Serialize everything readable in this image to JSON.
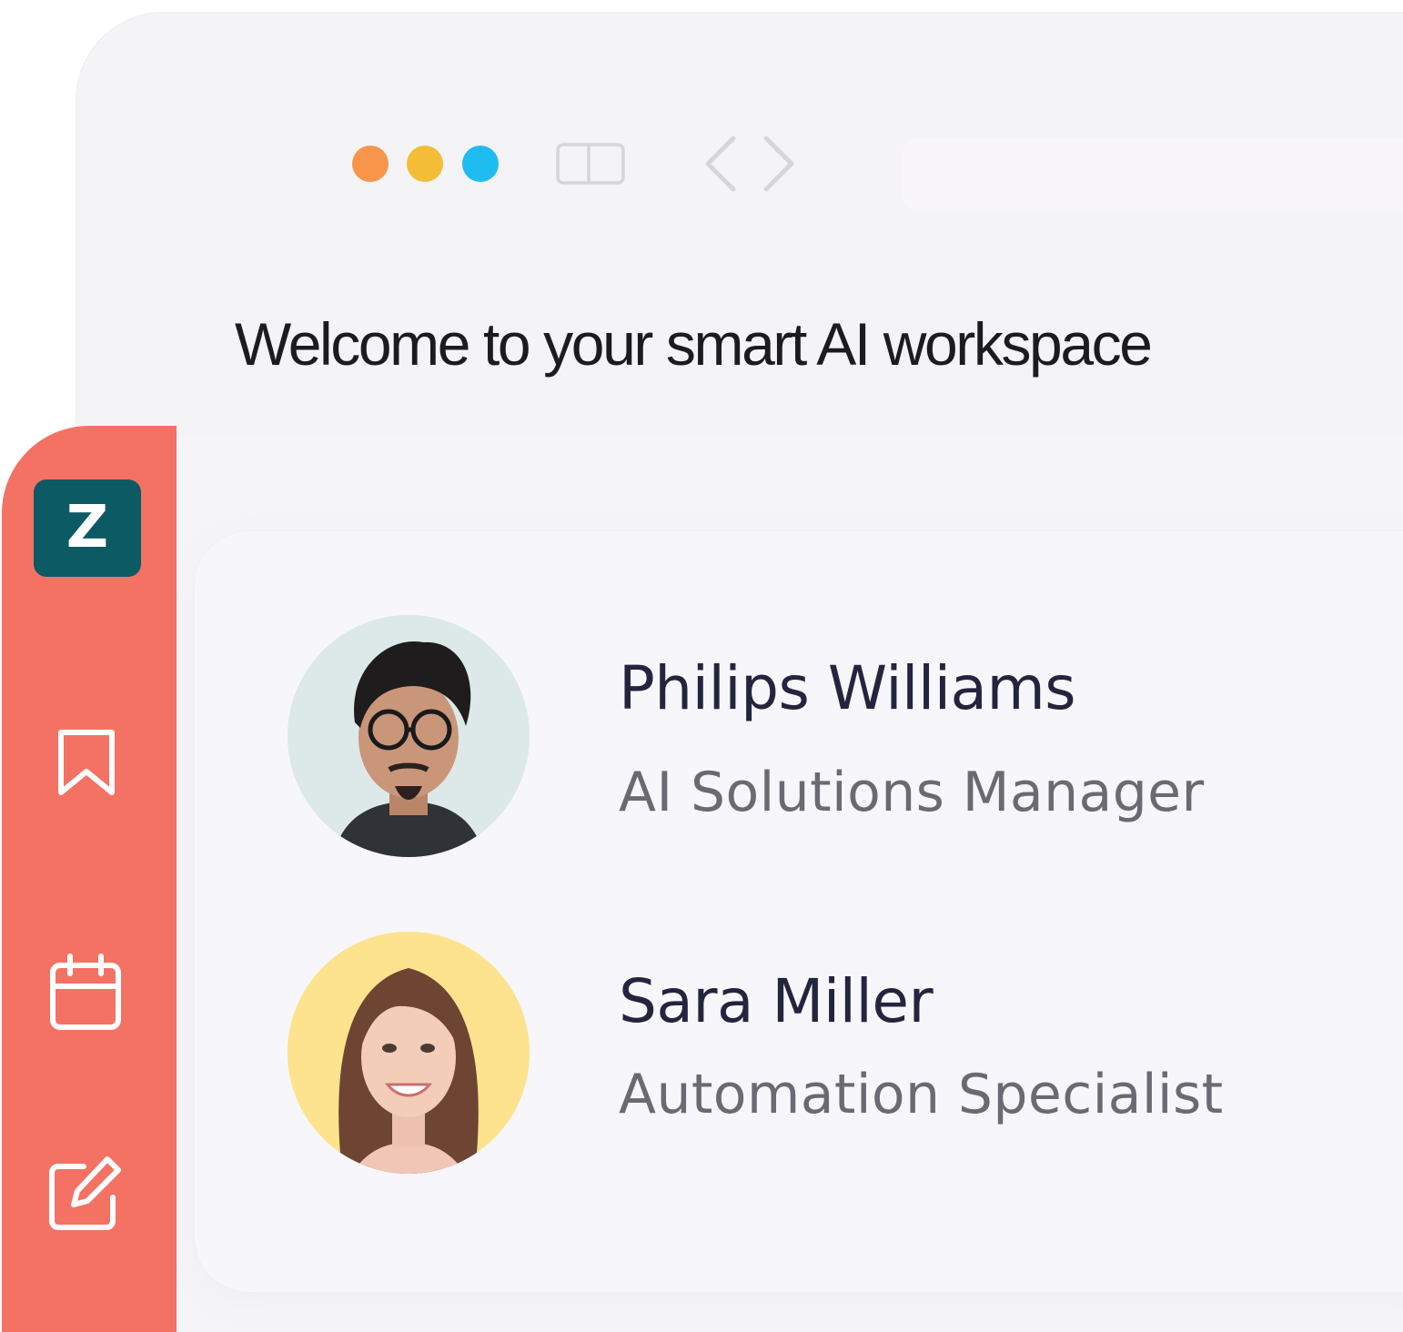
{
  "window": {
    "traffic_lights": [
      {
        "name": "traffic-light-orange",
        "color": "#f7954b"
      },
      {
        "name": "traffic-light-yellow",
        "color": "#f3bd38"
      },
      {
        "name": "traffic-light-blue",
        "color": "#1fbcf2"
      }
    ],
    "toolbar_icons": [
      "sidebar-toggle-icon",
      "back-chevron-icon",
      "forward-chevron-icon"
    ]
  },
  "header": {
    "title": "Welcome to your smart AI workspace"
  },
  "rail": {
    "logo_letter": "Z",
    "colors": {
      "rail": "#f47263",
      "logo_bg": "#0c5a63"
    },
    "icons": [
      "bookmark-icon",
      "calendar-icon",
      "edit-icon"
    ]
  },
  "people": [
    {
      "name": "Philips Williams",
      "role": "AI Solutions Manager",
      "avatar_bg": "#dde9e9"
    },
    {
      "name": "Sara Miller",
      "role": "Automation Specialist",
      "avatar_bg": "#fde38e"
    }
  ]
}
